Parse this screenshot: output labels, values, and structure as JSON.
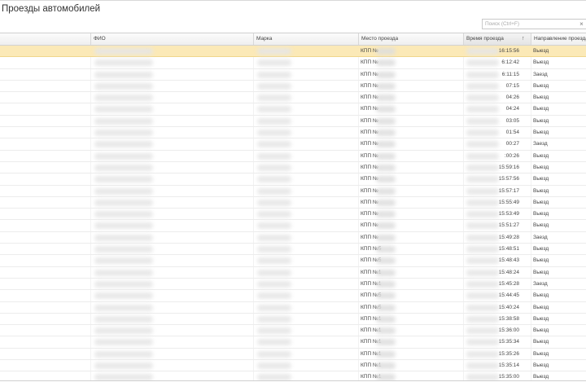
{
  "window": {
    "title": "Проезды автомобилей"
  },
  "search": {
    "placeholder": "Поиск (Ctrl+F)",
    "clear_glyph": "×"
  },
  "grid": {
    "columns": [
      "",
      "ФИО",
      "Марка",
      "Место проезда",
      "Время проезда",
      "Направление проезда"
    ],
    "sorted_column": "Время проезда",
    "sort_glyph": "↑",
    "selected_row": 0,
    "rows": [
      {
        "place": "КПП №",
        "time": "16:15:56",
        "direction": "Выезд"
      },
      {
        "place": "КПП №",
        "time": "6:12:42",
        "direction": "Выезд"
      },
      {
        "place": "КПП №",
        "time": "6:11:15",
        "direction": "Заезд"
      },
      {
        "place": "КПП №",
        "time": "07:15",
        "direction": "Выезд"
      },
      {
        "place": "КПП №",
        "time": "04:26",
        "direction": "Выезд"
      },
      {
        "place": "КПП №",
        "time": "04:24",
        "direction": "Выезд"
      },
      {
        "place": "КПП №",
        "time": "03:05",
        "direction": "Выезд"
      },
      {
        "place": "КПП №",
        "time": "01:54",
        "direction": "Выезд"
      },
      {
        "place": "КПП №",
        "time": "00:27",
        "direction": "Заезд"
      },
      {
        "place": "КПП №",
        "time": ":00:26",
        "direction": "Выезд"
      },
      {
        "place": "КПП №",
        "time": "15:59:16",
        "direction": "Выезд"
      },
      {
        "place": "КПП №",
        "time": "15:57:56",
        "direction": "Выезд"
      },
      {
        "place": "КПП №",
        "time": "15:57:17",
        "direction": "Выезд"
      },
      {
        "place": "КПП №",
        "time": "15:55:49",
        "direction": "Выезд"
      },
      {
        "place": "КПП №",
        "time": "15:53:49",
        "direction": "Выезд"
      },
      {
        "place": "КПП №",
        "time": "15:51:27",
        "direction": "Выезд"
      },
      {
        "place": "КПП №",
        "time": "15:49:28",
        "direction": "Заезд"
      },
      {
        "place": "КПП №5",
        "time": "15:48:51",
        "direction": "Выезд"
      },
      {
        "place": "КПП №5",
        "time": "15:48:43",
        "direction": "Выезд"
      },
      {
        "place": "КПП №1",
        "time": "15:48:24",
        "direction": "Выезд"
      },
      {
        "place": "КПП №1",
        "time": "15:45:28",
        "direction": "Заезд"
      },
      {
        "place": "КПП №5",
        "time": "15:44:45",
        "direction": "Выезд"
      },
      {
        "place": "КПП №5",
        "time": "15:40:24",
        "direction": "Выезд"
      },
      {
        "place": "КПП №1",
        "time": "15:38:58",
        "direction": "Выезд"
      },
      {
        "place": "КПП №1",
        "time": "15:36:00",
        "direction": "Выезд"
      },
      {
        "place": "КПП №1",
        "time": "15:35:34",
        "direction": "Выезд"
      },
      {
        "place": "КПП №1",
        "time": "15:35:26",
        "direction": "Выезд"
      },
      {
        "place": "КПП №1",
        "time": "15:35:14",
        "direction": "Выезд"
      },
      {
        "place": "КПП №1",
        "time": "15:35:00",
        "direction": "Выезд"
      }
    ]
  }
}
